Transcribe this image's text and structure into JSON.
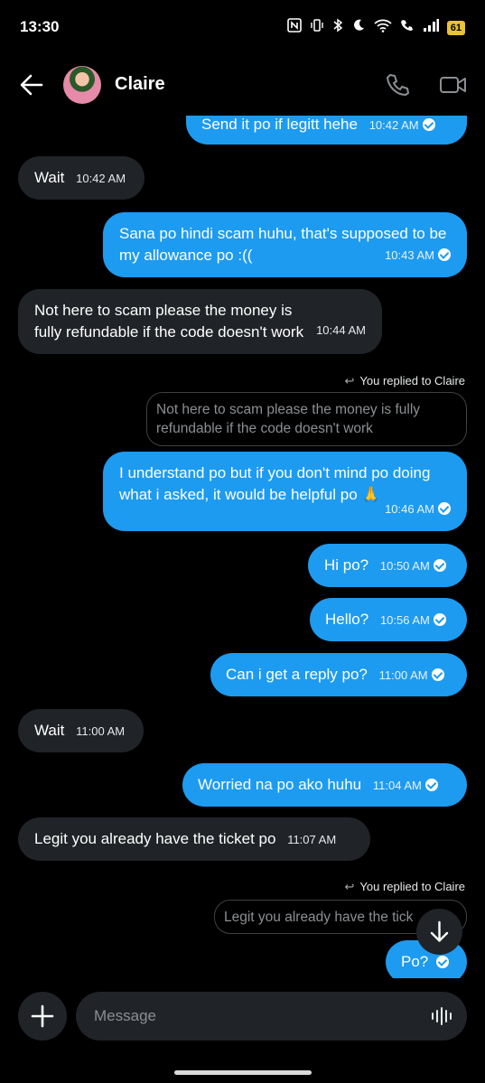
{
  "status_bar": {
    "time": "13:30",
    "battery": "61",
    "icons": [
      "nfc-icon",
      "vibrate-icon",
      "bluetooth-icon",
      "moon-icon",
      "wifi-icon",
      "wifi-call-icon",
      "signal-icon",
      "battery-icon"
    ]
  },
  "header": {
    "contact_name": "Claire",
    "icons": [
      "back-arrow-icon",
      "avatar",
      "phone-icon",
      "video-icon"
    ]
  },
  "messages": [
    {
      "dir": "out",
      "text": "Send it po if legitt hehe",
      "time": "10:42 AM"
    },
    {
      "dir": "in",
      "text": "Wait",
      "time": "10:42 AM"
    },
    {
      "dir": "out",
      "text": "Sana po hindi scam huhu, that's supposed to be my allowance po :((",
      "time": "10:43 AM"
    },
    {
      "dir": "in",
      "text": "Not here to scam please the money is fully refundable if the code doesn't work",
      "time": "10:44 AM"
    },
    {
      "dir": "out",
      "text": "I understand po but if you don't mind po doing what i asked, it would be helpful po 🙏",
      "time": "10:46 AM"
    },
    {
      "dir": "out",
      "text": "Hi po?",
      "time": "10:50 AM"
    },
    {
      "dir": "out",
      "text": "Hello?",
      "time": "10:56 AM"
    },
    {
      "dir": "out",
      "text": "Can i get a reply po?",
      "time": "11:00 AM"
    },
    {
      "dir": "in",
      "text": "Wait",
      "time": "11:00 AM"
    },
    {
      "dir": "out",
      "text": "Worried na po ako huhu",
      "time": "11:04 AM"
    },
    {
      "dir": "in",
      "text": "Legit you already have the  ticket po",
      "time": "11:07 AM"
    },
    {
      "dir": "out",
      "text": "Po?",
      "time": ""
    }
  ],
  "replies": [
    {
      "label": "You replied to Claire",
      "quoted": "Not here to scam please the money is fully refundable if the code doesn't work"
    },
    {
      "label": "You replied to Claire",
      "quoted": "Legit you already have the  tick"
    }
  ],
  "composer": {
    "placeholder": "Message",
    "icons": [
      "plus-icon",
      "voice-wave-icon",
      "arrow-down-icon"
    ]
  },
  "colors": {
    "outgoing_bubble": "#1d9bf0",
    "incoming_bubble": "#202327",
    "background": "#000000",
    "battery": "#e8c233"
  }
}
